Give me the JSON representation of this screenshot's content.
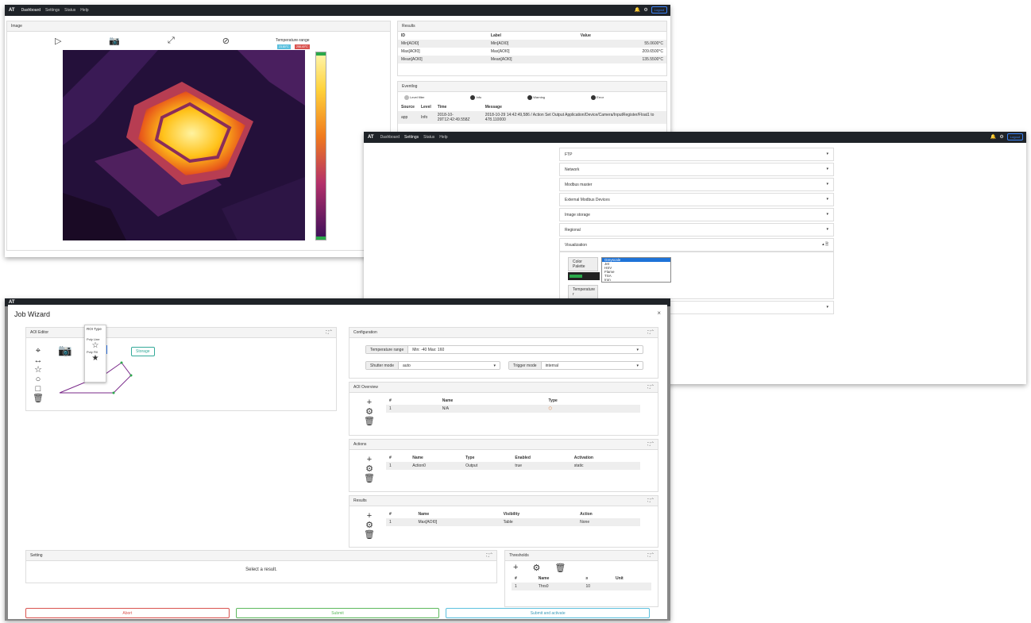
{
  "nav": {
    "brand": "AT",
    "links": [
      "Dashboard",
      "Settings",
      "Status",
      "Help"
    ],
    "logout": "Logout"
  },
  "dashboard": {
    "image_title": "Image",
    "temp_range_label": "Temperature-range",
    "temp_min": "23.80°C",
    "temp_max": "258.40°C",
    "results_title": "Results",
    "results_headers": [
      "ID",
      "Label",
      "Value"
    ],
    "results_rows": [
      [
        "Min[AOI0]",
        "Min[AOI0]",
        "55.0600°C"
      ],
      [
        "Max[AOI0]",
        "Max[AOI0]",
        "209.6500°C"
      ],
      [
        "Mean[AOI0]",
        "Mean[AOI0]",
        "135.5500°C"
      ]
    ],
    "eventlog_title": "Eventlog",
    "level_filter": "Level filter",
    "levels": [
      "Info",
      "Warning",
      "Error"
    ],
    "log_headers": [
      "Source",
      "Level",
      "Time",
      "Message"
    ],
    "log_row": {
      "source": "app",
      "level": "Info",
      "time": "2018-10-29T12:42:49.558Z",
      "message": "2018-10-29 14:42:49,586 / Action Set Output Application/Device/Camera/InputRegister/Float1 to 478.110000"
    }
  },
  "settings": {
    "sections": [
      "FTP",
      "Network",
      "Modbus master",
      "External Modbus Devices",
      "Image storage",
      "Regional",
      "Visualization"
    ],
    "color_palette_label": "Color Palette",
    "palette_options": [
      "Greyscale",
      "Jet",
      "HSV",
      "Flame",
      "TSA",
      "Iron"
    ],
    "palette_selected": "Greyscale",
    "temperature_label": "Temperature r"
  },
  "wizard": {
    "title": "Job Wizard",
    "close": "×",
    "aoi_editor": "AOI Editor",
    "roi_type": "ROI Type",
    "roi_options": [
      "Poly Line",
      "Poly Fill"
    ],
    "storage_btn": "Storage",
    "configuration": "Configuration",
    "temp_range_lbl": "Temperature range",
    "temp_range_val": "Min: -40 Max: 160",
    "shutter_lbl": "Shutter mode",
    "shutter_val": "auto",
    "trigger_lbl": "Trigger mode",
    "trigger_val": "internal",
    "aoi_overview": "AOI Overview",
    "aoi_headers": [
      "#",
      "Name",
      "Type"
    ],
    "aoi_row": [
      "1",
      "N/A"
    ],
    "actions": "Actions",
    "action_headers": [
      "#",
      "Name",
      "Type",
      "Enabled",
      "Activation"
    ],
    "action_row": [
      "1",
      "Action0",
      "Output",
      "true",
      "static"
    ],
    "results": "Results",
    "result_headers": [
      "#",
      "Name",
      "Visibility",
      "Action"
    ],
    "result_row": [
      "1",
      "Max[AOI0]",
      "Table",
      "None"
    ],
    "setting": "Setting",
    "select_result": "Select a result.",
    "thresholds": "Thresholds",
    "threshold_headers": [
      "#",
      "Name",
      "≥",
      "Unit"
    ],
    "threshold_row": [
      "1",
      "Thrs0",
      "10",
      ""
    ],
    "abort": "Abort",
    "submit": "Submit",
    "submit_activate": "Submit and activate"
  },
  "colors": {
    "nav": "#1f2328",
    "accent": "#3b82f6",
    "abort": "#d9534f",
    "submit": "#5cb85c",
    "teal": "#5bc0de"
  }
}
